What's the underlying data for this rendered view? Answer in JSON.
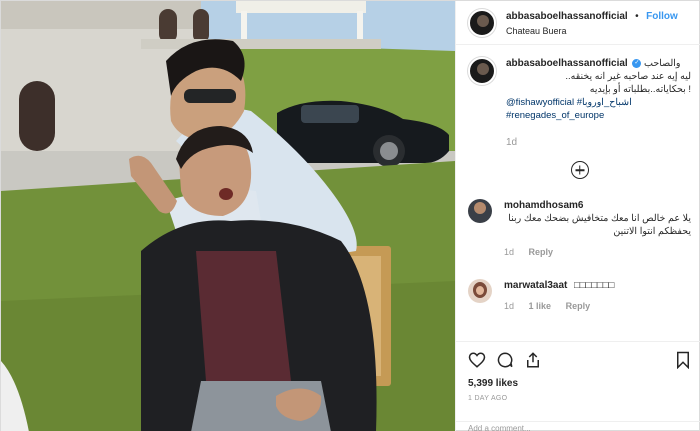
{
  "post": {
    "username": "abbasaboelhassanofficial",
    "follow_label": "Follow",
    "separator": "•",
    "location": "Chateau Buera",
    "caption_line1": "والصاحب",
    "caption_line2": "ليه إيه عند صاحبه غير انه يخنقه..",
    "caption_line3": "! بحكاياته..بطلباته أو بإيديه",
    "caption_tag1": "@fishawyofficial #اشباح_اوروبا",
    "caption_tag2": "#renegades_of_europe",
    "caption_time": "1d",
    "verified_mark": "✓"
  },
  "comments": [
    {
      "username": "mohamdhosam6",
      "text": "يلا عم خالص انا معك متخافيش بضحك معك ربنا يحفظكم انتوا الاتنين",
      "time": "1d",
      "reply_label": "Reply"
    },
    {
      "username": "marwatal3aat",
      "text": "□□□□□□□",
      "time": "1d",
      "likes": "1 like",
      "reply_label": "Reply"
    }
  ],
  "actions": {
    "likes": "5,399 likes",
    "ago": "1 DAY AGO",
    "add_comment_placeholder": "Add a comment..."
  },
  "icons": [
    "heart-icon",
    "comment-icon",
    "share-icon",
    "bookmark-icon",
    "add-icon"
  ],
  "colors": {
    "link": "#3897f0",
    "hashtag": "#003569",
    "muted": "#999999"
  }
}
